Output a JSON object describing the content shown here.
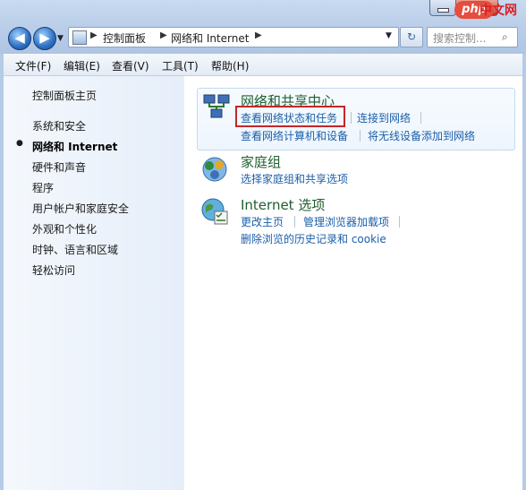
{
  "window": {
    "close_glyph": "✕",
    "min_glyph": ""
  },
  "nav": {
    "back_glyph": "◀",
    "fwd_glyph": "▶",
    "history_glyph": "▼",
    "refresh_glyph": "↻"
  },
  "address": {
    "breadcrumb": [
      "控制面板",
      "网络和 Internet"
    ],
    "separator": "▶",
    "dropdown_glyph": "▼"
  },
  "search": {
    "placeholder": "搜索控制...",
    "icon": "search-icon",
    "icon_glyph": "⌕"
  },
  "menu": {
    "items": [
      "文件(F)",
      "编辑(E)",
      "查看(V)",
      "工具(T)",
      "帮助(H)"
    ]
  },
  "sidebar": {
    "home": "控制面板主页",
    "items": [
      "系统和安全",
      "网络和 Internet",
      "硬件和声音",
      "程序",
      "用户帐户和家庭安全",
      "外观和个性化",
      "时钟、语言和区域",
      "轻松访问"
    ],
    "current_index": 1,
    "bullet": "●"
  },
  "categories": [
    {
      "title": "网络和共享中心",
      "icon": "network-icon",
      "links": [
        "查看网络状态和任务",
        "连接到网络",
        "查看网络计算机和设备",
        "将无线设备添加到网络"
      ]
    },
    {
      "title": "家庭组",
      "icon": "homegroup-icon",
      "links": [
        "选择家庭组和共享选项"
      ]
    },
    {
      "title": "Internet 选项",
      "icon": "internet-options-icon",
      "links": [
        "更改主页",
        "管理浏览器加载项",
        "删除浏览的历史记录和 cookie"
      ]
    }
  ],
  "watermark": {
    "logo": "php",
    "text": "中文网"
  },
  "colors": {
    "link": "#1b5faa",
    "category_title": "#1e5f2f",
    "highlight": "#c1272d"
  }
}
